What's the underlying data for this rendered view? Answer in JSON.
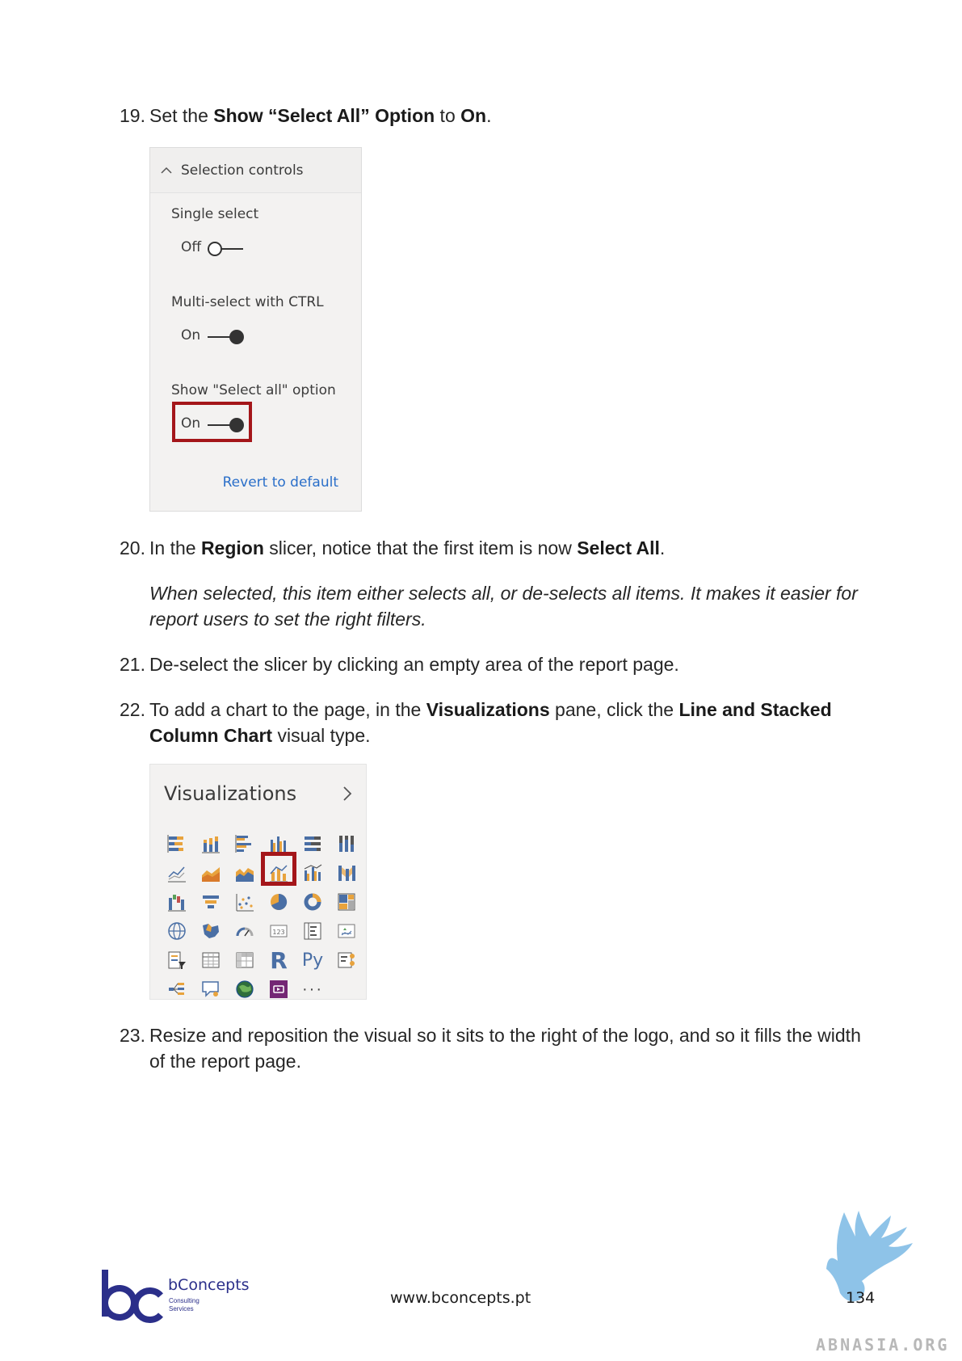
{
  "steps": {
    "s19": {
      "num": "19.",
      "pre": "Set the ",
      "b1": "Show “Select All” Option",
      "mid": " to ",
      "b2": "On",
      "post": "."
    },
    "s20": {
      "num": "20.",
      "pre": "In the ",
      "b1": "Region",
      "mid": " slicer, notice that the first item is now ",
      "b2": "Select All",
      "post": "."
    },
    "s20_note": "When selected, this item either selects all, or de-selects all items. It makes it easier for report users to set the right filters.",
    "s21": {
      "num": "21.",
      "text": "De-select the slicer by clicking an empty area of the report page."
    },
    "s22": {
      "num": "22.",
      "pre": "To add a chart to the page, in the ",
      "b1": "Visualizations",
      "mid": " pane, click the ",
      "b2": "Line and Stacked Column Chart",
      "post": " visual type."
    },
    "s23": {
      "num": "23.",
      "text": "Resize and reposition the visual so it sits to the right of the logo, and so it fills the width of the report page."
    }
  },
  "selection_panel": {
    "title": "Selection controls",
    "options": [
      {
        "label": "Single select",
        "state": "Off"
      },
      {
        "label": "Multi-select with CTRL",
        "state": "On"
      },
      {
        "label": "Show \"Select all\" option",
        "state": "On"
      }
    ],
    "revert": "Revert to default",
    "highlight_color": "#a4161a",
    "link_color": "#2a6fc9"
  },
  "viz_panel": {
    "title": "Visualizations",
    "icons": [
      "stacked-bar-chart-icon",
      "stacked-column-chart-icon",
      "clustered-bar-chart-icon",
      "clustered-column-chart-icon",
      "100-stacked-bar-chart-icon",
      "100-stacked-column-chart-icon",
      "line-chart-icon",
      "area-chart-icon",
      "stacked-area-chart-icon",
      "line-and-stacked-column-chart-icon",
      "line-and-clustered-column-chart-icon",
      "ribbon-chart-icon",
      "waterfall-chart-icon",
      "funnel-icon",
      "scatter-chart-icon",
      "pie-chart-icon",
      "donut-chart-icon",
      "treemap-icon",
      "map-icon",
      "filled-map-icon",
      "gauge-icon",
      "card-icon",
      "multi-row-card-icon",
      "kpi-icon",
      "slicer-icon",
      "table-icon",
      "matrix-icon",
      "r-visual-icon",
      "python-visual-icon",
      "key-influencers-icon",
      "decomposition-tree-icon",
      "qa-icon",
      "arcgis-map-icon",
      "power-apps-icon",
      "more-visuals-icon"
    ],
    "r_glyph": "R",
    "py_glyph": "Py",
    "more_glyph": "···",
    "selected_icon": "line-and-stacked-column-chart-icon"
  },
  "footer": {
    "brand": "bConcepts",
    "brand_sub1": "Consulting",
    "brand_sub2": "Services",
    "url": "www.bconcepts.pt",
    "page": "134",
    "watermark": "ABNASIA.ORG",
    "brand_color": "#2b2f8a"
  }
}
